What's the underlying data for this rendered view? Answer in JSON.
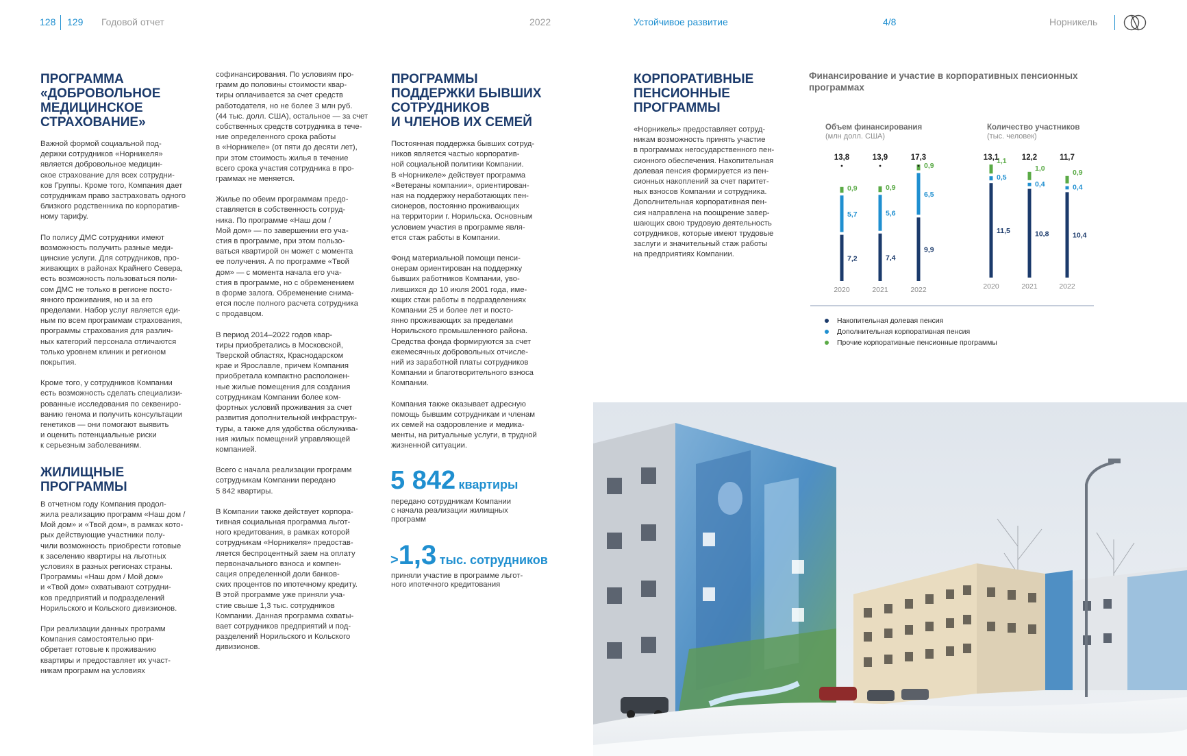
{
  "header": {
    "page_left": "128",
    "page_right": "129",
    "report_title": "Годовой отчет",
    "year": "2022",
    "section": "Устойчивое развитие",
    "section_page": "4/8",
    "company": "Норникель",
    "logo_icon": "nornickel-logo-icon"
  },
  "col1": {
    "dms_heading": "ПРОГРАММА\n«ДОБРОВОЛЬНОЕ\nМЕДИЦИНСКОЕ\nСТРАХОВАНИЕ»",
    "dms_p1": "Важной формой социальной под-\nдержки сотрудников «Норникеля»\nявляется добровольное медицин-\nское страхование для всех сотрудни-\nков Группы. Кроме того, Компания дает\nсотрудникам право застраховать одного\nблизкого родственника по корпоратив-\nному тарифу.",
    "dms_p2": "По полису ДМС сотрудники имеют\nвозможность получить разные меди-\nцинские услуги. Для сотрудников, про-\nживающих в районах Крайнего Севера,\nесть возможность пользоваться поли-\nсом ДМС не только в регионе посто-\nянного проживания, но и за его\nпределами. Набор услуг является еди-\nным по всем программам страхования,\nпрограммы страхования для различ-\nных категорий персонала отличаются\nтолько уровнем клиник и регионом\nпокрытия.",
    "dms_p3": "Кроме того, у сотрудников Компании\nесть возможность сделать специализи-\nрованные исследования по секвениро-\nванию генома и получить консультации\nгенетиков — они помогают выявить\nи оценить потенциальные риски\nк серьезным заболеваниям.",
    "housing_heading": "ЖИЛИЩНЫЕ\nПРОГРАММЫ",
    "housing_p1": "В отчетном году Компания продол-\nжила реализацию программ «Наш дом /\nМой дом» и «Твой дом», в рамках кото-\nрых действующие участники полу-\nчили возможность приобрести готовые\nк заселению квартиры на льготных\nусловиях в разных регионах страны.\nПрограммы «Наш дом / Мой дом»\nи «Твой дом» охватывают сотрудни-\nков предприятий и подразделений\nНорильского и Кольского дивизионов.",
    "housing_p2": "При реализации данных программ\nКомпания самостоятельно при-\nобретает готовые к проживанию\nквартиры и предоставляет их участ-\nникам программ на условиях"
  },
  "col2": {
    "p1": "софинансирования. По условиям про-\nграмм до половины стоимости квар-\nтиры оплачивается за счет средств\nработодателя, но не более 3 млн руб.\n(44 тыс. долл. США), остальное — за счет\nсобственных средств сотрудника в тече-\nние определенного срока работы\nв «Норникеле» (от пяти до десяти лет),\nпри этом стоимость жилья в течение\nвсего срока участия сотрудника в про-\nграммах не меняется.",
    "p2": "Жилье по обеим программам предо-\nставляется в собственность сотруд-\nника. По программе «Наш дом /\nМой дом» — по завершении его уча-\nстия в программе, при этом пользо-\nваться квартирой он может с момента\nее получения. А по программе «Твой\nдом» — с момента начала его уча-\nстия в программе, но с обременением\nв форме залога. Обременение снима-\nется после полного расчета сотрудника\nс продавцом.",
    "p3": "В период 2014–2022 годов квар-\nтиры приобретались в Московской,\nТверской областях, Краснодарском\nкрае и Ярославле, причем Компания\nприобретала компактно расположен-\nные жилые помещения для создания\nсотрудникам Компании более ком-\nфортных условий проживания за счет\nразвития дополнительной инфраструк-\nтуры, а также для удобства обслужива-\nния жилых помещений управляющей\nкомпанией.",
    "p4": "Всего с начала реализации программ\nсотрудникам Компании передано\n5 842 квартиры.",
    "p5": "В Компании также действует корпора-\nтивная социальная программа льгот-\nного кредитования, в рамках которой\nсотрудникам «Норникеля» предостав-\nляется беспроцентный заем на оплату\nпервоначального взноса и компен-\nсация определенной доли банков-\nских процентов по ипотечному кредиту.\nВ этой программе уже приняли уча-\nстие свыше 1,3 тыс. сотрудников\nКомпании. Данная программа охваты-\nвает сотрудников предприятий и под-\nразделений Норильского и Кольского\nдивизионов."
  },
  "col3": {
    "heading": "ПРОГРАММЫ\nПОДДЕРЖКИ БЫВШИХ\nСОТРУДНИКОВ\nИ ЧЛЕНОВ ИХ СЕМЕЙ",
    "p1": "Постоянная поддержка бывших сотруд-\nников является частью корпоратив-\nной социальной политики Компании.\nВ «Норникеле» действует программа\n«Ветераны компании», ориентирован-\nная на поддержку неработающих пен-\nсионеров, постоянно проживающих\nна территории г. Норильска. Основным\nусловием участия в программе явля-\nется стаж работы в Компании.",
    "p2": "Фонд материальной помощи пенси-\nонерам ориентирован на поддержку\nбывших работников Компании, уво-\nлившихся до 10 июля 2001 года, име-\nющих стаж работы в подразделениях\nКомпании 25 и более лет и посто-\nянно проживающих за пределами\nНорильского промышленного района.\nСредства фонда формируются за счет\nежемесячных добровольных отчисле-\nний из заработной платы сотрудников\nКомпании и благотворительного взноса\nКомпании.",
    "p3": "Компания также оказывает адресную\nпомощь бывшим сотрудникам и членам\nих семей на оздоровление и медика-\nменты, на ритуальные услуги, в трудной\nжизненной ситуации.",
    "stat1_value": "5 842",
    "stat1_unit": "квартиры",
    "stat1_desc": "передано сотрудникам Компании\nс начала реализации жилищных\nпрограмм",
    "stat2_prefix": ">",
    "stat2_value": "1,3",
    "stat2_unit": "тыс. сотрудников",
    "stat2_desc": "приняли участие в программе льгот-\nного ипотечного кредитования"
  },
  "col4": {
    "heading": "КОРПОРАТИВНЫЕ\nПЕНСИОННЫЕ\nПРОГРАММЫ",
    "p1": "«Норникель» предоставляет сотруд-\nникам возможность принять участие\nв программах негосударственного пен-\nсионного обеспечения. Накопительная\nдолевая пенсия формируется из пен-\nсионных накоплений за счет паритет-\nных взносов Компании и сотрудника.\nДополнительная корпоративная пен-\nсия направлена на поощрение завер-\nшающих свою трудовую деятельность\nсотрудников, которые имеют трудовые\nзаслуги и значительный стаж работы\nна предприятиях Компании."
  },
  "chart_heading": "Финансирование и участие в корпоративных пенсионных\nпрограммах",
  "legend": [
    {
      "label": "Накопительная долевая пенсия",
      "color": "#1b3a6b"
    },
    {
      "label": "Дополнительная корпоративная пенсия",
      "color": "#1f8fd0"
    },
    {
      "label": "Прочие корпоративные пенсионные программы",
      "color": "#5aaa46"
    }
  ],
  "chart_data": [
    {
      "type": "bar",
      "stacked": true,
      "title": "Объем финансирования",
      "subtitle": "(млн долл. США)",
      "categories": [
        "2020",
        "2021",
        "2022"
      ],
      "totals": [
        "13,8",
        "13,9",
        "17,3"
      ],
      "series": [
        {
          "name": "Накопительная долевая пенсия",
          "values": [
            7.2,
            7.4,
            9.9
          ],
          "labels": [
            "7,2",
            "7,4",
            "9,9"
          ]
        },
        {
          "name": "Дополнительная корпоративная пенсия",
          "values": [
            5.7,
            5.6,
            6.5
          ],
          "labels": [
            "5,7",
            "5,6",
            "6,5"
          ]
        },
        {
          "name": "Прочие корпоративные пенсионные программы",
          "values": [
            0.9,
            0.9,
            0.9
          ],
          "labels": [
            "0,9",
            "0,9",
            "0,9"
          ]
        }
      ]
    },
    {
      "type": "bar",
      "stacked": true,
      "title": "Количество участников",
      "subtitle": "(тыс. человек)",
      "categories": [
        "2020",
        "2021",
        "2022"
      ],
      "totals": [
        "13,1",
        "12,2",
        "11,7"
      ],
      "series": [
        {
          "name": "Накопительная долевая пенсия",
          "values": [
            11.5,
            10.8,
            10.4
          ],
          "labels": [
            "11,5",
            "10,8",
            "10,4"
          ]
        },
        {
          "name": "Дополнительная корпоративная пенсия",
          "values": [
            0.5,
            0.4,
            0.4
          ],
          "labels": [
            "0,5",
            "0,4",
            "0,4"
          ]
        },
        {
          "name": "Прочие корпоративные пенсионные программы",
          "values": [
            1.1,
            1.0,
            0.9
          ],
          "labels": [
            "1,1",
            "1,0",
            "0,9"
          ]
        }
      ]
    }
  ],
  "photo": {
    "subject": "snowy-courtyard-with-mural-buildings"
  }
}
